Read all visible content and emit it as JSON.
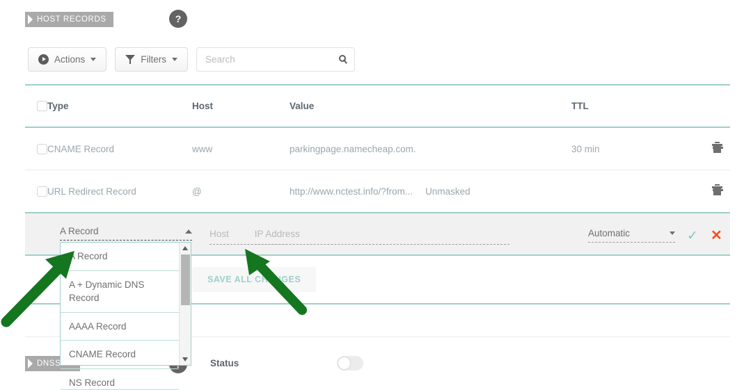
{
  "sections": {
    "host_records_label": "HOST RECORDS",
    "dnssec_label": "DNSSEC",
    "help_glyph": "?"
  },
  "toolbar": {
    "actions_label": "Actions",
    "filters_label": "Filters",
    "search_placeholder": "Search",
    "search_value": ""
  },
  "table": {
    "columns": [
      "Type",
      "Host",
      "Value",
      "TTL"
    ],
    "rows": [
      {
        "type": "CNAME Record",
        "host": "www",
        "value": "parkingpage.namecheap.com.",
        "extra": "",
        "ttl": "30 min"
      },
      {
        "type": "URL Redirect Record",
        "host": "@",
        "value": "http://www.nctest.info/?from...",
        "extra": "Unmasked",
        "ttl": ""
      }
    ]
  },
  "edit_row": {
    "type_value": "A Record",
    "host_placeholder": "Host",
    "address_placeholder": "IP Address",
    "ttl_value": "Automatic",
    "confirm_glyph": "✓",
    "cancel_glyph": "✕"
  },
  "dropdown": {
    "options": [
      "A Record",
      "A + Dynamic DNS Record",
      "AAAA Record",
      "CNAME Record",
      "NS Record"
    ]
  },
  "save": {
    "label": "SAVE ALL CHANGES"
  },
  "dnssec": {
    "status_label": "Status",
    "status_on": false
  },
  "colors": {
    "teal_rule": "#9fcfcb",
    "ribbon_gray": "#a9a9a9",
    "accent_red": "#f4511e",
    "annotation_green": "#14761f"
  }
}
